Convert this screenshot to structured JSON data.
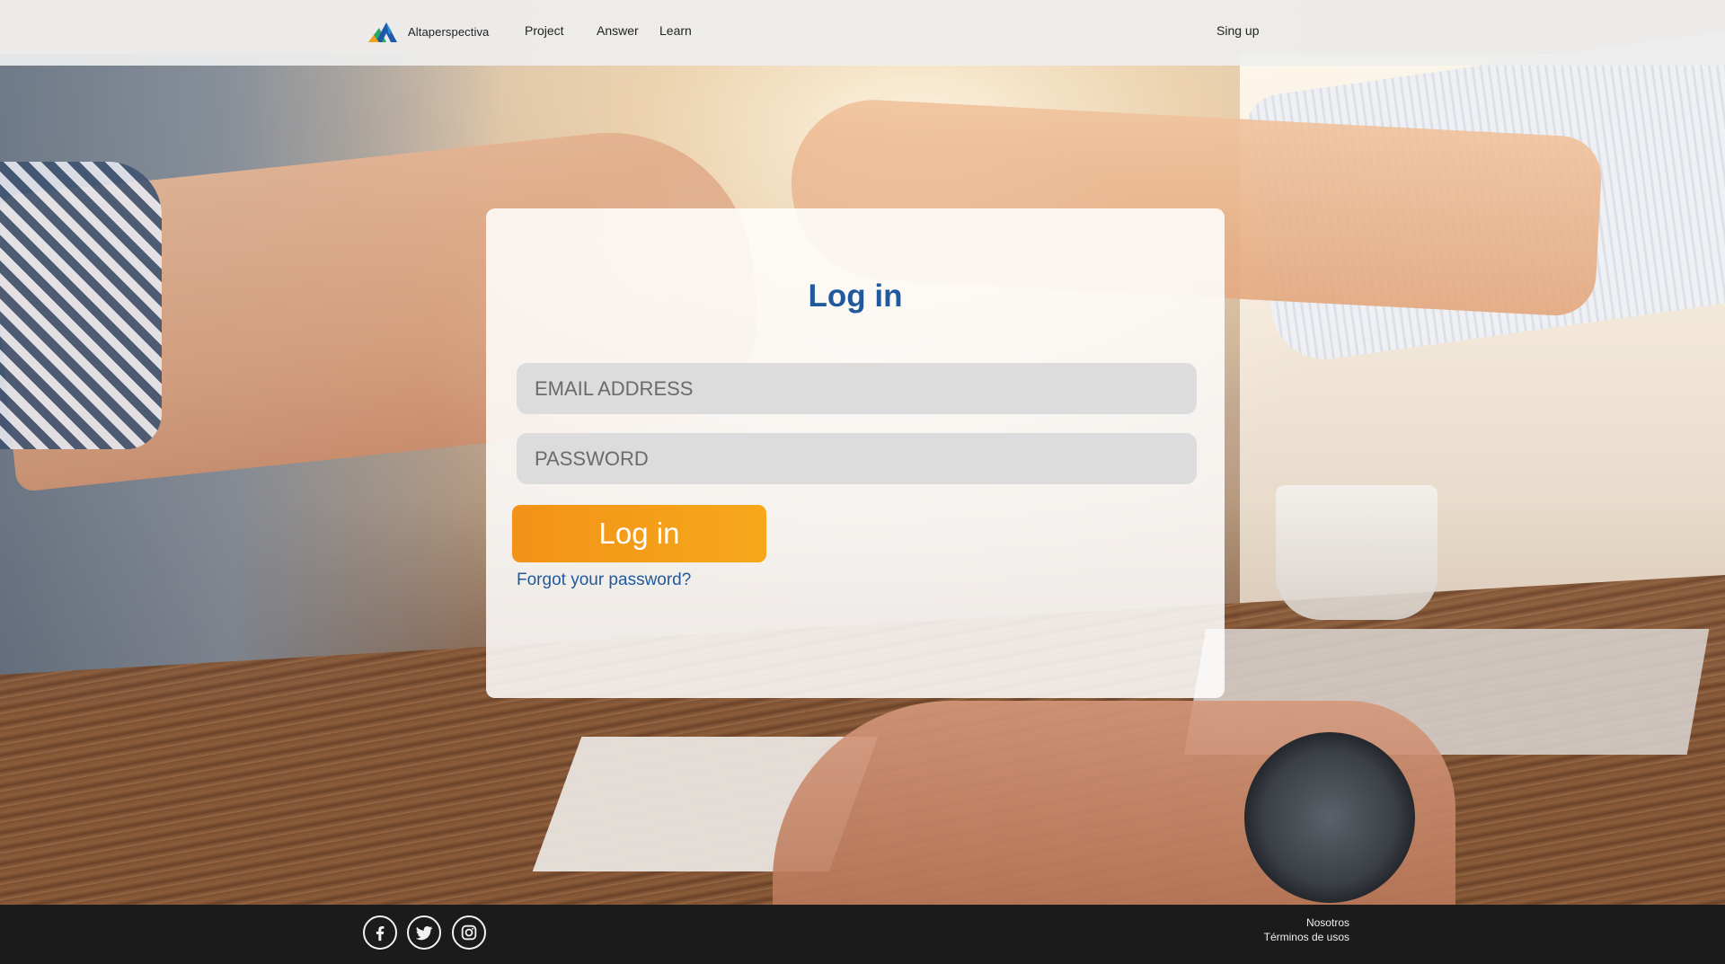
{
  "header": {
    "brand_name": "Altaperspectiva",
    "nav": {
      "project": "Project",
      "answer": "Answer",
      "learn": "Learn",
      "signup": "Sing up"
    }
  },
  "login": {
    "title": "Log in",
    "email_placeholder": "EMAIL ADDRESS",
    "password_placeholder": "PASSWORD",
    "submit_label": "Log in",
    "forgot_label": "Forgot your password?"
  },
  "footer": {
    "social_icons": [
      "facebook-icon",
      "twitter-icon",
      "instagram-icon"
    ],
    "links": {
      "nosotros": "Nosotros",
      "terminos": "Términos de usos"
    }
  },
  "colors": {
    "accent_blue": "#1f5a9e",
    "button_orange": "#f39219",
    "footer_bg": "#1b1b1b",
    "input_bg": "#dcdcdc"
  }
}
